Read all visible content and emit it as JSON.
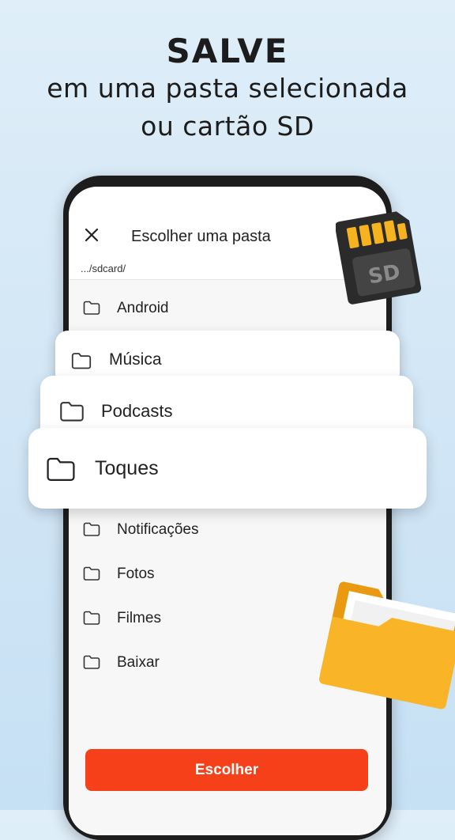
{
  "headline": {
    "line1": "SALVE",
    "line2": "em uma pasta selecionada",
    "line3": "ou cartão SD"
  },
  "dialog": {
    "title": "Escolher uma pasta",
    "path": ".../sdcard/",
    "close_icon": "close-icon",
    "folders": [
      {
        "label": "Android"
      },
      {
        "label": "Notificações"
      },
      {
        "label": "Fotos"
      },
      {
        "label": "Filmes"
      },
      {
        "label": "Baixar"
      }
    ],
    "highlighted_folders": [
      {
        "label": "Música"
      },
      {
        "label": "Podcasts"
      },
      {
        "label": "Toques"
      }
    ],
    "choose_button": "Escolher"
  },
  "decor": {
    "sd_card_label": "SD"
  },
  "colors": {
    "accent": "#f5401a",
    "background": "#d3e7f6",
    "folder": "#f9b427"
  }
}
